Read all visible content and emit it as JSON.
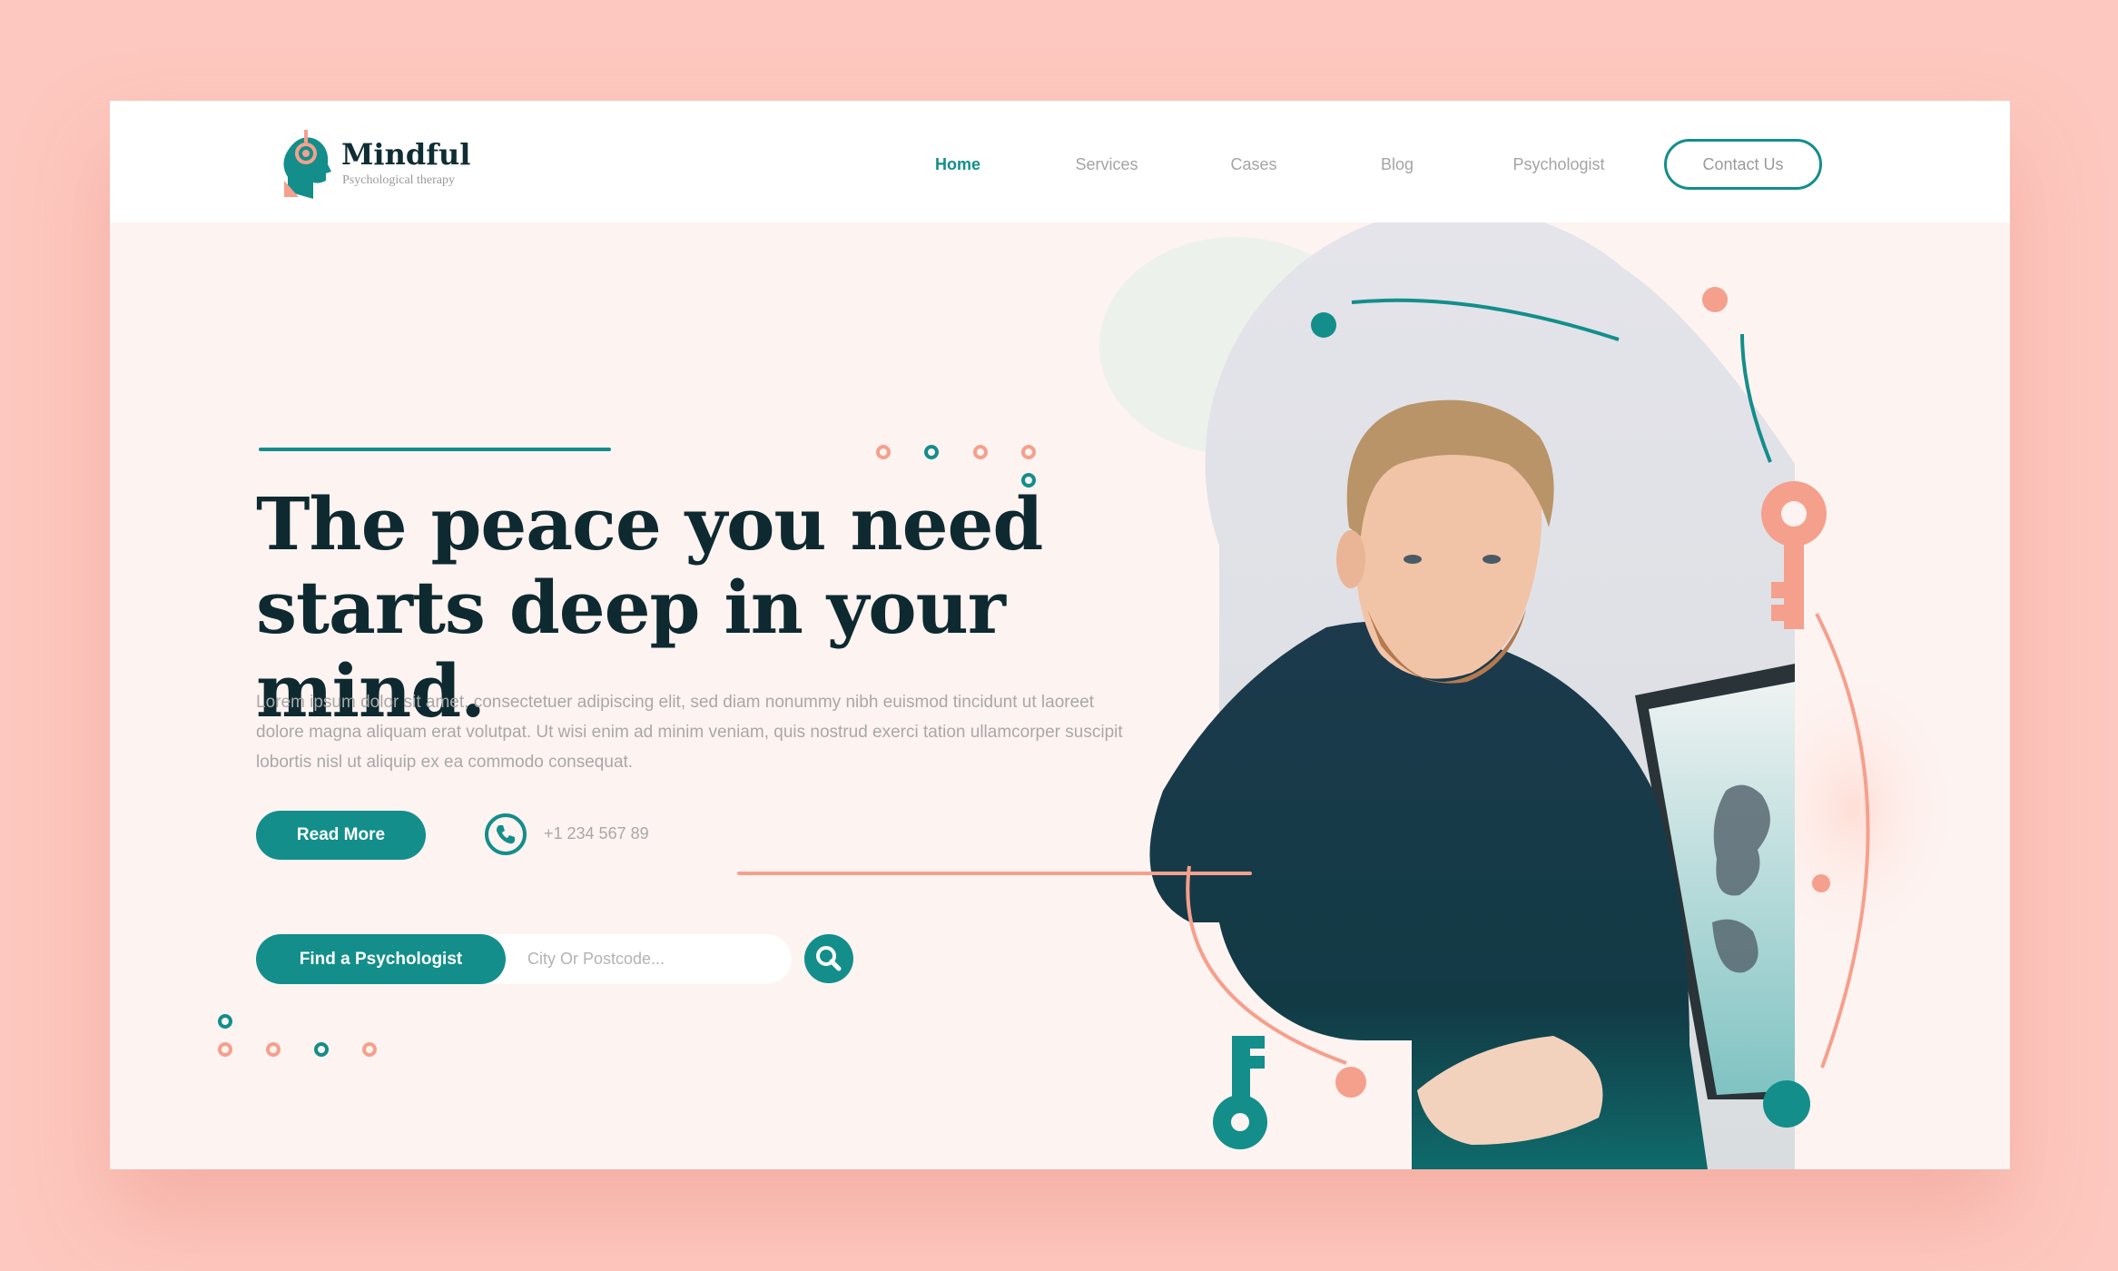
{
  "brand": {
    "name": "Mindful",
    "tagline": "Psychological therapy",
    "logo_icon": "head-lotus-icon"
  },
  "nav": {
    "items": [
      {
        "label": "Home",
        "active": true
      },
      {
        "label": "Services",
        "active": false
      },
      {
        "label": "Cases",
        "active": false
      },
      {
        "label": "Blog",
        "active": false
      },
      {
        "label": "Psychologist",
        "active": false
      }
    ],
    "contact_label": "Contact Us"
  },
  "hero": {
    "headline_line1": "The peace you need",
    "headline_line2": "starts deep in your mind.",
    "body": "Lorem ipsum dolor sit amet, consectetuer adipiscing elit, sed diam nonummy nibh euismod tincidunt ut laoreet dolore magna aliquam erat volutpat. Ut wisi enim ad minim veniam, quis nostrud exerci tation ullamcorper suscipit lobortis nisl ut aliquip ex ea commodo consequat.",
    "read_more_label": "Read More",
    "phone_icon": "phone-icon",
    "phone": "+1 234 567 89"
  },
  "search": {
    "button_label": "Find a Psychologist",
    "placeholder": "City Or Postcode...",
    "icon": "search-icon"
  },
  "colors": {
    "teal": "#138e8b",
    "coral": "#f5a08c",
    "dark": "#0e2a30",
    "page_bg": "#fdc8bf",
    "hero_bg": "#fdf3f1"
  }
}
